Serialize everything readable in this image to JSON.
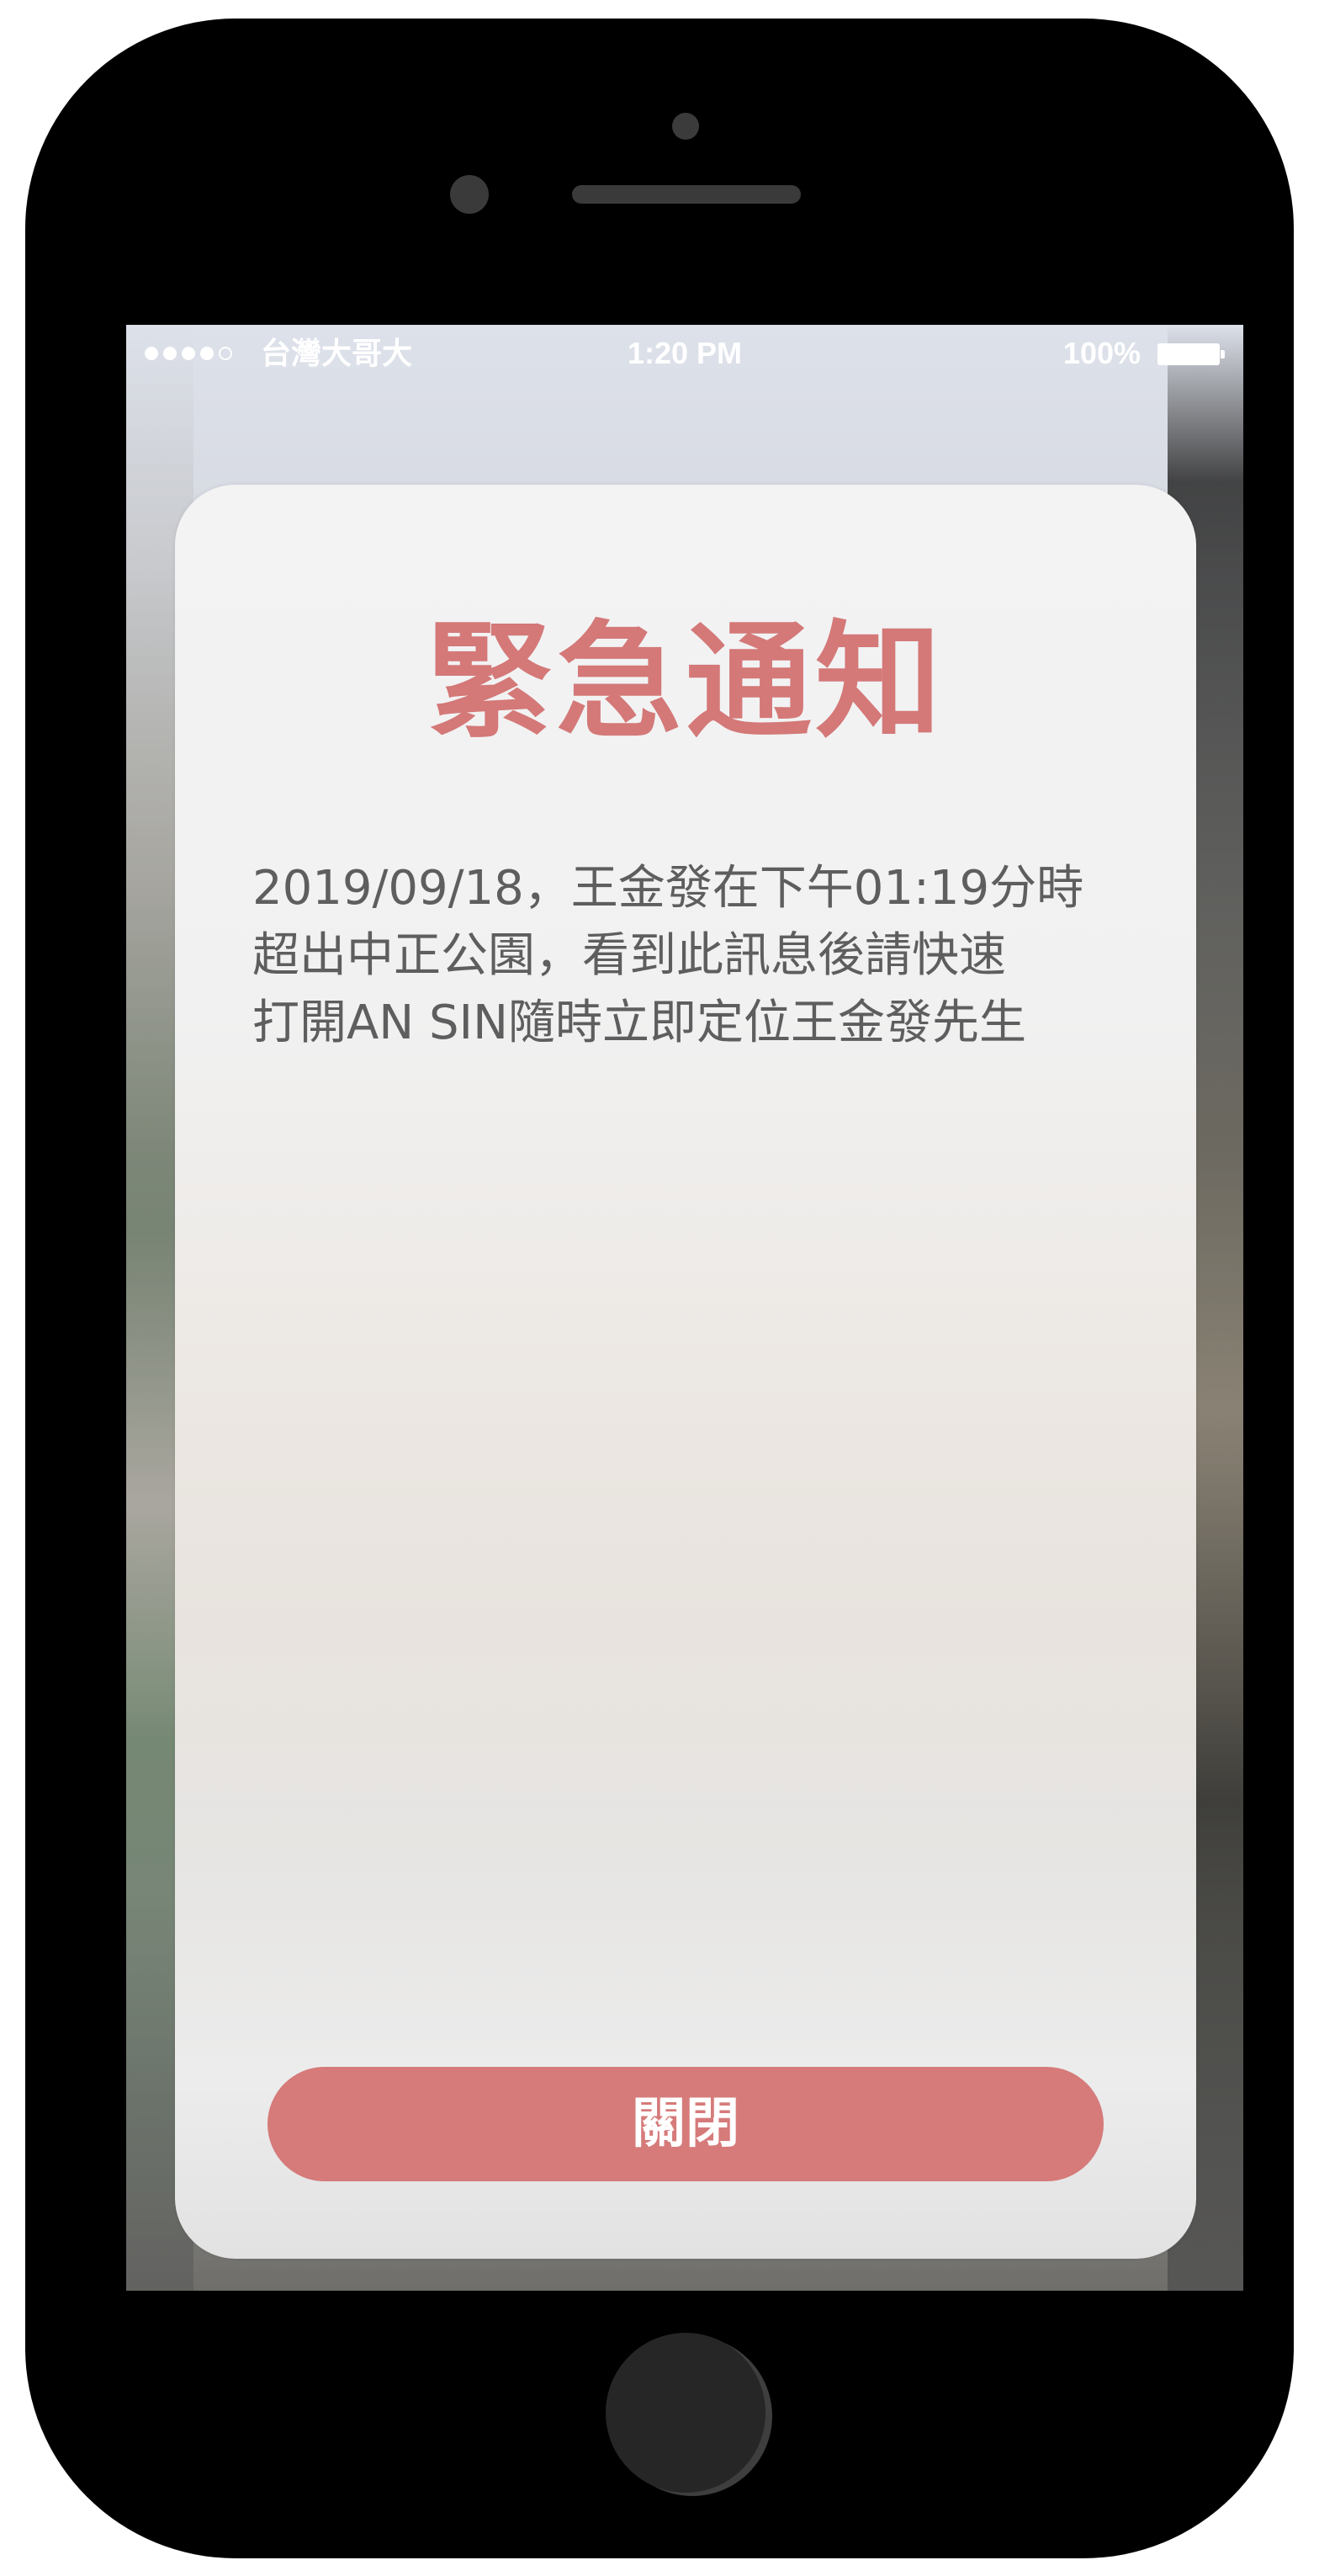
{
  "status_bar": {
    "carrier": "台灣大哥大",
    "time": "1:20 PM",
    "battery": "100%",
    "signal_bars_filled": 4,
    "signal_bars_total": 5
  },
  "alert": {
    "title": "緊急通知",
    "message_lines": [
      "2019/09/18，王金發在下午01:19分時",
      "超出中正公園，看到此訊息後請快速",
      "打開AN SIN隨時立即定位王金發先生"
    ],
    "close_label": "關閉"
  },
  "colors": {
    "accent": "#d67a7a",
    "title": "#d47878",
    "message_text": "#5e5e5e",
    "phone_frame": "#000000"
  },
  "icons": {
    "signal": "signal-dots-icon",
    "battery": "battery-icon"
  }
}
